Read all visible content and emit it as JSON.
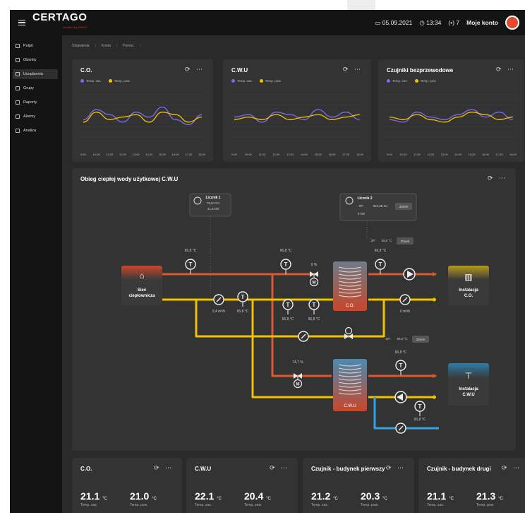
{
  "app": {
    "logo": "CERTAGO",
    "logo_sub": "created by DACO",
    "date": "05.09.2021",
    "time": "13:34",
    "alarms": "7",
    "account": "Moje konto"
  },
  "sidebar": {
    "items": [
      {
        "label": "Pulpit",
        "icon": "home-icon"
      },
      {
        "label": "Obiekty",
        "icon": "bar-chart-icon"
      },
      {
        "label": "Urządzenia",
        "icon": "device-icon",
        "active": true
      },
      {
        "label": "Grupy",
        "icon": "group-icon"
      },
      {
        "label": "Raporty",
        "icon": "report-icon"
      },
      {
        "label": "Alarmy",
        "icon": "alarm-icon"
      },
      {
        "label": "Analiza",
        "icon": "analysis-icon"
      }
    ]
  },
  "breadcrumb": [
    "Ustawienia",
    "Konta",
    "Pomoc"
  ],
  "charts": [
    {
      "title": "C.O.",
      "legend": [
        "Temp. zas.",
        "Temp. pow."
      ]
    },
    {
      "title": "C.W.U",
      "legend": [
        "Temp. zas.",
        "Temp. pow."
      ]
    },
    {
      "title": "Czujniki bezprzewodowe",
      "legend": [
        "Temp. zas.",
        "Temp. pow."
      ]
    }
  ],
  "chart_data": [
    {
      "type": "line",
      "x": [
        "9:00",
        "10:00",
        "11:00",
        "12:00",
        "13:00",
        "14:00",
        "15:00",
        "16:00",
        "17:00",
        "18:00"
      ],
      "series": [
        {
          "name": "Temp. zas.",
          "color": "#7b6cf0",
          "values": [
            22,
            26,
            24,
            21,
            25,
            23,
            27,
            22,
            20,
            24
          ]
        },
        {
          "name": "Temp. pow.",
          "color": "#f2c200",
          "values": [
            21,
            25,
            22,
            23,
            24,
            21,
            25,
            24,
            21,
            23
          ]
        }
      ]
    },
    {
      "type": "line",
      "x": [
        "9:00",
        "10:00",
        "11:00",
        "12:00",
        "13:00",
        "14:00",
        "15:00",
        "16:00",
        "17:00",
        "18:00"
      ],
      "series": [
        {
          "name": "Temp. zas.",
          "color": "#7b6cf0",
          "values": [
            23,
            24,
            21,
            25,
            24,
            22,
            26,
            23,
            25,
            22
          ]
        },
        {
          "name": "Temp. pow.",
          "color": "#f2c200",
          "values": [
            22,
            23,
            22,
            24,
            22,
            23,
            24,
            22,
            23,
            24
          ]
        }
      ]
    },
    {
      "type": "line",
      "x": [
        "9:00",
        "10:00",
        "11:00",
        "12:00",
        "13:00",
        "14:00",
        "15:00",
        "16:00",
        "17:00",
        "18:00"
      ],
      "series": [
        {
          "name": "Temp. zas.",
          "color": "#7b6cf0",
          "values": [
            22,
            21,
            25,
            23,
            22,
            24,
            26,
            23,
            25,
            22
          ]
        },
        {
          "name": "Temp. pow.",
          "color": "#f2c200",
          "values": [
            23,
            22,
            24,
            22,
            21,
            23,
            25,
            24,
            22,
            23
          ]
        }
      ]
    }
  ],
  "diagram": {
    "title": "Obieg ciepłej wody użytkowej C.W.U",
    "meter1": {
      "title": "Licznik 1",
      "l1": "78,84 GJ",
      "l2": "41,8 kW"
    },
    "meter2": {
      "title": "Licznik 2",
      "l1": "923,08 GJ",
      "l2": "0 kW",
      "sp": "SP:",
      "btn": "Zmień"
    },
    "source": "Sieć ciepłownicza",
    "co": "C.O.",
    "cwu": "C.W.U",
    "inst_co": "Instalacja C.O.",
    "inst_cwu": "Instalacja C.W.U",
    "t1": "65,8 °C",
    "t2": "66,8 °C",
    "t3": "66,8 °C",
    "t4": "65,8 °C",
    "t5": "66,8 °C",
    "t6": "66,8 °C",
    "t7": "66,8 °C",
    "t8": "65,8 °C",
    "flow1": "0,4 m³/h",
    "flow2": "0 m³/h",
    "valve1": "0 %",
    "valve2": "74,7 %",
    "sp1": "SP:",
    "sp1_val": "55,0 °C",
    "sp1_btn": "Zmień",
    "sp2": "SP:",
    "sp2_val": "55,0 °C",
    "sp2_btn": "Zmień"
  },
  "summary": [
    {
      "title": "C.O.",
      "v1": "21.1",
      "v2": "21.0",
      "unit": "°C",
      "l1": "Temp. zas.",
      "l2": "Temp. pow."
    },
    {
      "title": "C.W.U",
      "v1": "22.1",
      "v2": "20.4",
      "unit": "°C",
      "l1": "Temp. zas.",
      "l2": "Temp. pow."
    },
    {
      "title": "Czujnik - budynek pierwszy",
      "v1": "21.2",
      "v2": "20.3",
      "unit": "°C",
      "l1": "Temp. zas.",
      "l2": "Temp. pow."
    },
    {
      "title": "Czujnik - budynek drugi",
      "v1": "21.1",
      "v2": "21.3",
      "unit": "°C",
      "l1": "Temp. zas.",
      "l2": "Temp. pow."
    }
  ],
  "colors": {
    "hot": "#e0562f",
    "cold": "#f2c200",
    "blue": "#3aa0e0",
    "accent": "#7b6cf0"
  }
}
